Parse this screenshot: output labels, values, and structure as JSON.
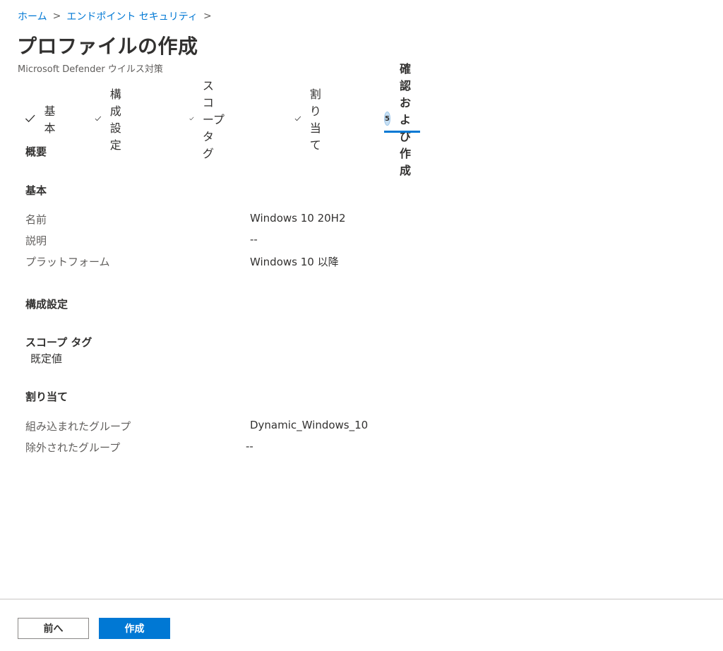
{
  "breadcrumb": {
    "items": [
      {
        "label": "ホーム"
      },
      {
        "label": "エンドポイント セキュリティ"
      }
    ],
    "separator": ">"
  },
  "page": {
    "title": "プロファイルの作成",
    "subtitle": "Microsoft Defender ウイルス対策"
  },
  "wizard": {
    "steps": [
      {
        "label": "基本",
        "state": "completed",
        "icon": "checkmark-icon"
      },
      {
        "label": "構成設定",
        "state": "completed",
        "icon": "checkmark-icon"
      },
      {
        "label": "スコープ タグ",
        "state": "completed",
        "icon": "checkmark-icon"
      },
      {
        "label": "割り当て",
        "state": "completed",
        "icon": "checkmark-icon"
      },
      {
        "label": "確認および作成",
        "state": "active",
        "number": "5"
      }
    ],
    "accent_color": "#0078d4"
  },
  "summary": {
    "heading": "概要",
    "basics": {
      "heading": "基本",
      "rows": [
        {
          "label": "名前",
          "value": "Windows 10 20H2"
        },
        {
          "label": "説明",
          "value": "--"
        },
        {
          "label": "プラットフォーム",
          "value": "Windows 10 以降"
        }
      ]
    },
    "config": {
      "heading": "構成設定"
    },
    "scope": {
      "heading": "スコープ タグ",
      "value": "既定値"
    },
    "assignments": {
      "heading": "割り当て",
      "rows": [
        {
          "label": "組み込まれたグループ",
          "value": "Dynamic_Windows_10"
        },
        {
          "label": "除外されたグループ",
          "value": "--"
        }
      ]
    }
  },
  "footer": {
    "back_label": "前へ",
    "create_label": "作成"
  }
}
